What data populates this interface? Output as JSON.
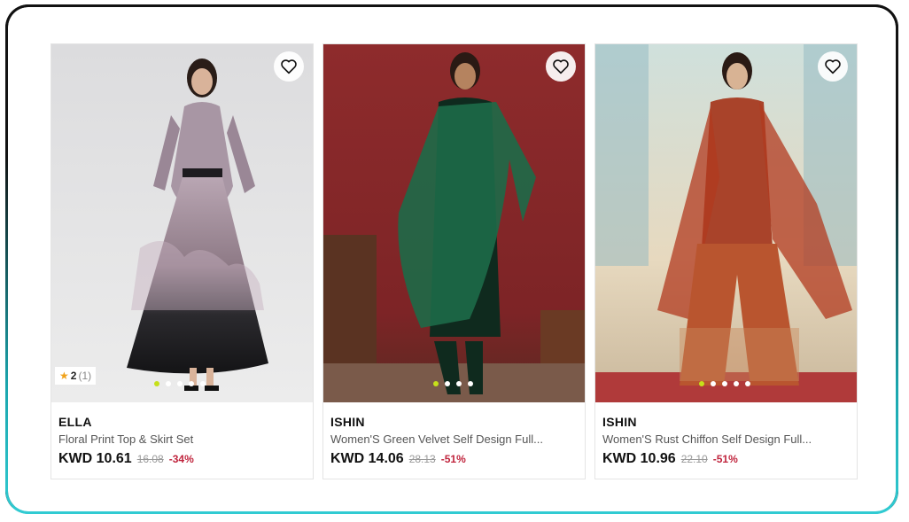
{
  "colors": {
    "accent_discount": "#c0243d",
    "dot_active": "#c6e01a",
    "star": "#f0a21a"
  },
  "products": [
    {
      "brand": "ELLA",
      "name": "Floral Print Top & Skirt Set",
      "price": "KWD 10.61",
      "old_price": "16.08",
      "discount": "-34%",
      "rating": "2",
      "rating_count": "(1)",
      "wishlist_icon": "heart-outline-icon",
      "image_slides": 5,
      "active_slide": 1
    },
    {
      "brand": "ISHIN",
      "name": "Women'S Green Velvet Self Design Full...",
      "price": "KWD 14.06",
      "old_price": "28.13",
      "discount": "-51%",
      "wishlist_icon": "heart-outline-icon",
      "image_slides": 4,
      "active_slide": 1
    },
    {
      "brand": "ISHIN",
      "name": "Women'S Rust Chiffon Self Design Full...",
      "price": "KWD 10.96",
      "old_price": "22.10",
      "discount": "-51%",
      "wishlist_icon": "heart-outline-icon",
      "image_slides": 5,
      "active_slide": 1
    }
  ]
}
